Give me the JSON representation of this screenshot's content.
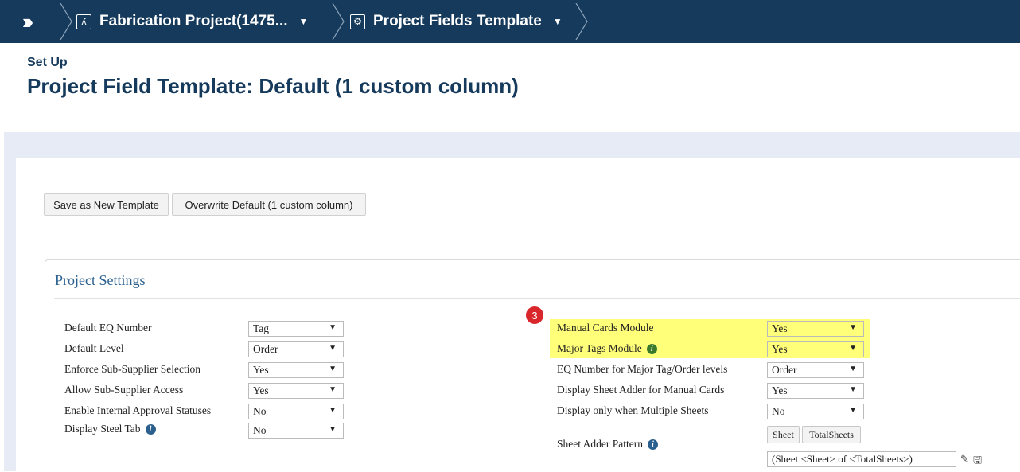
{
  "nav": {
    "crumb1": {
      "label": "Fabrication Project(1475...",
      "icon": "person-icon"
    },
    "crumb2": {
      "label": "Project Fields Template",
      "icon": "gear-icon"
    }
  },
  "header": {
    "setup": "Set Up",
    "title": "Project Field Template: Default (1 custom column)"
  },
  "buttons": {
    "save_new": "Save as New Template",
    "overwrite": "Overwrite Default (1 custom column)"
  },
  "project_settings": {
    "title": "Project Settings",
    "left": [
      {
        "label": "Default EQ Number",
        "value": "Tag"
      },
      {
        "label": "Default Level",
        "value": "Order"
      },
      {
        "label": "Enforce Sub-Supplier Selection",
        "value": "Yes"
      },
      {
        "label": "Allow Sub-Supplier Access",
        "value": "Yes"
      },
      {
        "label": "Enable Internal Approval Statuses",
        "value": "No"
      },
      {
        "label": "Display Steel Tab",
        "value": "No"
      }
    ],
    "right": [
      {
        "label": "Manual Cards Module",
        "value": "Yes"
      },
      {
        "label": "Major Tags Module",
        "value": "Yes"
      },
      {
        "label": "EQ Number for Major Tag/Order levels",
        "value": "Order"
      },
      {
        "label": "Display Sheet Adder for Manual Cards",
        "value": "Yes"
      },
      {
        "label": "Display only when Multiple Sheets",
        "value": "No"
      }
    ],
    "badge": "3",
    "sheet_adder": {
      "label": "Sheet Adder Pattern",
      "btn_sheet": "Sheet",
      "btn_total": "TotalSheets",
      "pattern": "(Sheet <Sheet> of <TotalSheets>)"
    }
  },
  "colors": {
    "nav_bg": "#163a5c",
    "title": "#163a5c",
    "highlight": "#ffff7a",
    "badge": "#d9262b"
  }
}
